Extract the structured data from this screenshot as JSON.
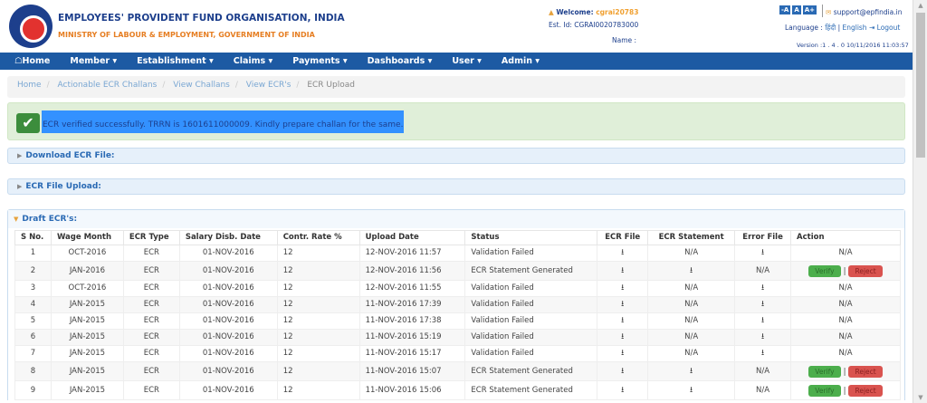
{
  "header": {
    "org_name": "EMPLOYEES' PROVIDENT FUND ORGANISATION, INDIA",
    "ministry": "MINISTRY OF LABOUR & EMPLOYMENT, GOVERNMENT OF INDIA",
    "welcome_label": "Welcome:",
    "username": "cgrai20783",
    "est_id": "Est. Id: CGRAI0020783000",
    "name_label": "Name :",
    "font_buttons": [
      "-A",
      "A",
      "A+"
    ],
    "support_email": "support@epfindia.in",
    "language_label": "Language :",
    "lang_hindi": "हिंदी",
    "lang_english": "English",
    "logout": "Logout",
    "version": "Version :1 . 4 . 0 10/11/2016 11:03:57"
  },
  "nav": {
    "items": [
      "Home",
      "Member ▾",
      "Establishment ▾",
      "Claims ▾",
      "Payments ▾",
      "Dashboards ▾",
      "User ▾",
      "Admin ▾"
    ]
  },
  "breadcrumb": [
    "Home",
    "Actionable ECR Challans",
    "View Challans",
    "View ECR's",
    "ECR Upload"
  ],
  "alert": {
    "message": "ECR verified successfully. TRRN is 1601611000009. Kindly prepare challan for the same."
  },
  "panels": {
    "download": "Download ECR File:",
    "upload": "ECR File Upload:",
    "draft": "Draft ECR's:"
  },
  "table": {
    "columns": [
      "S No.",
      "Wage Month",
      "ECR Type",
      "Salary Disb. Date",
      "Contr. Rate %",
      "Upload Date",
      "Status",
      "ECR File",
      "ECR Statement",
      "Error File",
      "Action"
    ],
    "verify_label": "Verify",
    "reject_label": "Reject",
    "na": "N/A",
    "rows": [
      {
        "sno": "1",
        "wage": "OCT-2016",
        "type": "ECR",
        "sal": "01-NOV-2016",
        "rate": "12",
        "upload": "12-NOV-2016 11:57",
        "status": "Validation Failed",
        "stmt": false,
        "err": true,
        "action": false
      },
      {
        "sno": "2",
        "wage": "JAN-2016",
        "type": "ECR",
        "sal": "01-NOV-2016",
        "rate": "12",
        "upload": "12-NOV-2016 11:56",
        "status": "ECR Statement Generated",
        "stmt": true,
        "err": false,
        "action": true
      },
      {
        "sno": "3",
        "wage": "OCT-2016",
        "type": "ECR",
        "sal": "01-NOV-2016",
        "rate": "12",
        "upload": "12-NOV-2016 11:55",
        "status": "Validation Failed",
        "stmt": false,
        "err": true,
        "action": false
      },
      {
        "sno": "4",
        "wage": "JAN-2015",
        "type": "ECR",
        "sal": "01-NOV-2016",
        "rate": "12",
        "upload": "11-NOV-2016 17:39",
        "status": "Validation Failed",
        "stmt": false,
        "err": true,
        "action": false
      },
      {
        "sno": "5",
        "wage": "JAN-2015",
        "type": "ECR",
        "sal": "01-NOV-2016",
        "rate": "12",
        "upload": "11-NOV-2016 17:38",
        "status": "Validation Failed",
        "stmt": false,
        "err": true,
        "action": false
      },
      {
        "sno": "6",
        "wage": "JAN-2015",
        "type": "ECR",
        "sal": "01-NOV-2016",
        "rate": "12",
        "upload": "11-NOV-2016 15:19",
        "status": "Validation Failed",
        "stmt": false,
        "err": true,
        "action": false
      },
      {
        "sno": "7",
        "wage": "JAN-2015",
        "type": "ECR",
        "sal": "01-NOV-2016",
        "rate": "12",
        "upload": "11-NOV-2016 15:17",
        "status": "Validation Failed",
        "stmt": false,
        "err": true,
        "action": false
      },
      {
        "sno": "8",
        "wage": "JAN-2015",
        "type": "ECR",
        "sal": "01-NOV-2016",
        "rate": "12",
        "upload": "11-NOV-2016 15:07",
        "status": "ECR Statement Generated",
        "stmt": true,
        "err": false,
        "action": true
      },
      {
        "sno": "9",
        "wage": "JAN-2015",
        "type": "ECR",
        "sal": "01-NOV-2016",
        "rate": "12",
        "upload": "11-NOV-2016 15:06",
        "status": "ECR Statement Generated",
        "stmt": true,
        "err": false,
        "action": true
      }
    ]
  }
}
